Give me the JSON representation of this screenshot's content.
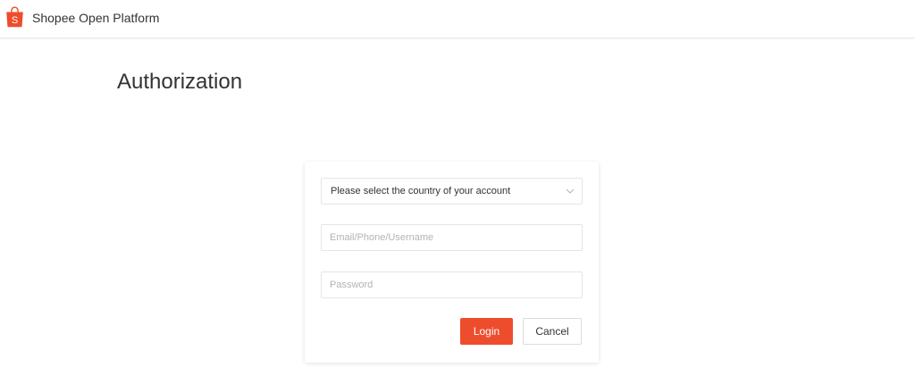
{
  "header": {
    "brand": "Shopee Open Platform",
    "logo_icon": "shopee-bag-icon",
    "brand_color": "#ee4d2d"
  },
  "main": {
    "title": "Authorization"
  },
  "form": {
    "country_select": {
      "value": "Please select the country of your account",
      "icon": "chevron-down-icon"
    },
    "email": {
      "value": "",
      "placeholder": "Email/Phone/Username"
    },
    "password": {
      "value": "",
      "placeholder": "Password"
    },
    "login_label": "Login",
    "cancel_label": "Cancel"
  },
  "colors": {
    "accent": "#ee4d2d",
    "border": "#e5e5e5",
    "text": "#333333",
    "placeholder": "#b3b3b3"
  }
}
